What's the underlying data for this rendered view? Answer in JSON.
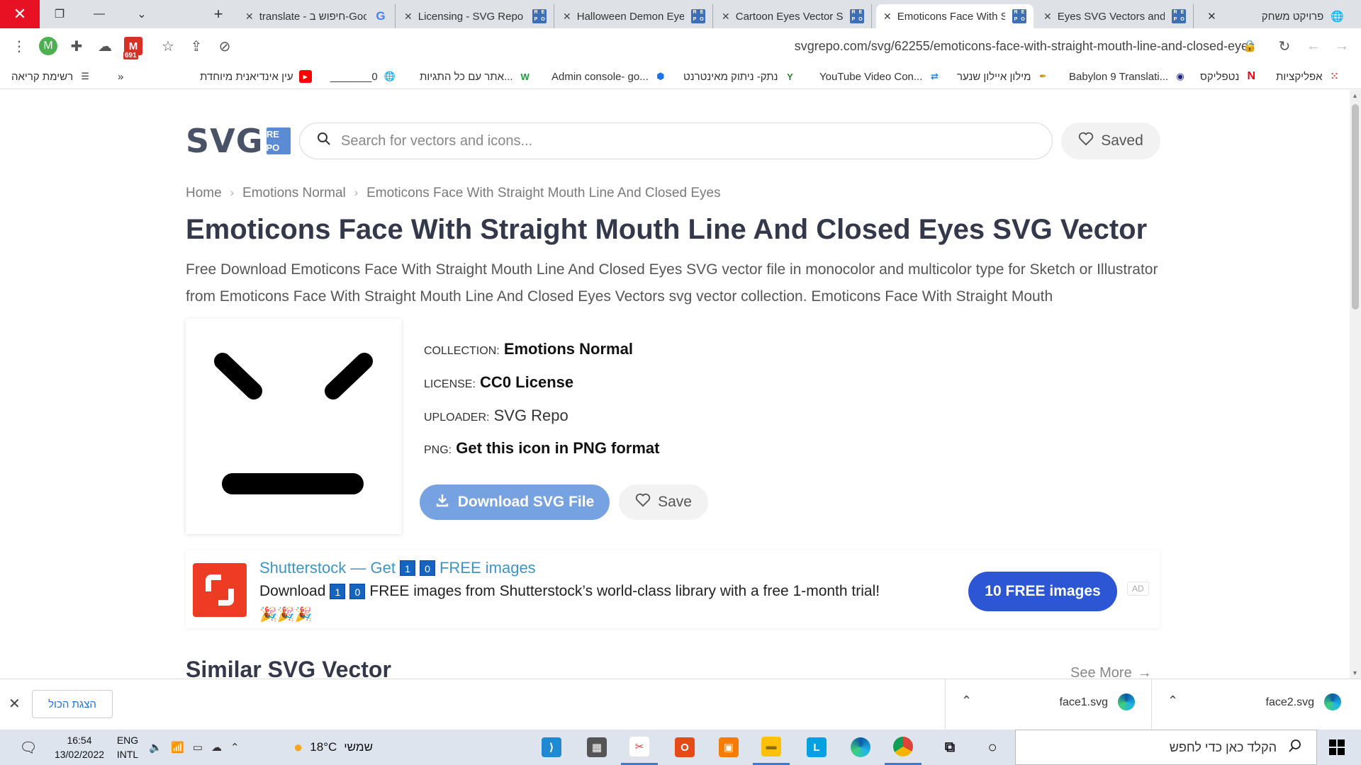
{
  "browser": {
    "tabs": [
      {
        "title": "translate - חיפוש ב-Google",
        "icon": "google-icon"
      },
      {
        "title": "Licensing - SVG Repo",
        "icon": "svgrepo-icon"
      },
      {
        "title": "Halloween Demon Eyes",
        "icon": "svgrepo-icon"
      },
      {
        "title": "Cartoon Eyes Vector S",
        "icon": "svgrepo-icon"
      },
      {
        "title": "Emoticons Face With S",
        "icon": "svgrepo-icon",
        "active": true
      },
      {
        "title": "Eyes SVG Vectors and",
        "icon": "svgrepo-icon"
      }
    ],
    "last_tab": "פרויקט משחק",
    "url": "svgrepo.com/svg/62255/emoticons-face-with-straight-mouth-line-and-closed-eyes",
    "gmail_count": "691",
    "profile_initial": "M",
    "bookmarks": [
      "אפליקציות",
      "נטפליקס",
      "Babylon 9 Translati...",
      "מילון איילון שנער",
      "YouTube Video Con...",
      "נתק- ניתוק מאינטרנט",
      "Admin console- go...",
      "אתר עם כל התגיות...",
      "_______0",
      "עין אינדיאנית מיוחדת",
      "רשימת קריאה"
    ],
    "bookmarks_overflow": "»"
  },
  "site": {
    "logo_main": "SVG",
    "logo_box": [
      "RE",
      "PO"
    ],
    "search_placeholder": "Search for vectors and icons...",
    "saved_label": "Saved",
    "breadcrumb": [
      "Home",
      "Emotions Normal",
      "Emoticons Face With Straight Mouth Line And Closed Eyes"
    ],
    "title": "Emoticons Face With Straight Mouth Line And Closed Eyes SVG Vector",
    "description": "Free Download Emoticons Face With Straight Mouth Line And Closed Eyes SVG vector file in monocolor and multicolor type for Sketch or Illustrator from Emoticons Face With Straight Mouth Line And Closed Eyes Vectors svg vector collection. Emoticons Face With Straight Mouth",
    "meta": {
      "collection_key": "COLLECTION:",
      "collection_val": "Emotions Normal",
      "license_key": "LICENSE:",
      "license_val": "CC0 License",
      "uploader_key": "UPLOADER:",
      "uploader_val": "SVG Repo",
      "png_key": "PNG:",
      "png_val": "Get this icon in PNG format"
    },
    "download_label": "Download SVG File",
    "save_label": "Save",
    "ad": {
      "title_pre": "Shutterstock — Get",
      "title_post": "FREE images",
      "text_pre": "Download",
      "text_post": "FREE images from Shutterstock’s world-class library with a free 1-month trial!",
      "digits": [
        "1",
        "0"
      ],
      "emoji": "🎉🎉🎉",
      "cta": "10 FREE images",
      "tag": "AD"
    },
    "similar_heading": "Similar SVG Vector",
    "see_more": "See More"
  },
  "downloads": {
    "show_all": "הצגת הכול",
    "items": [
      "face1.svg",
      "face2.svg"
    ]
  },
  "taskbar": {
    "search_placeholder": "הקלד כאן כדי לחפש",
    "weather_temp": "18°C",
    "weather_text": "שמשי",
    "lang_top": "ENG",
    "lang_bottom": "INTL",
    "time": "16:54",
    "date": "13/02/2022"
  },
  "colors": {
    "accent_blue": "#76a2e2",
    "cta_blue": "#2d56d4",
    "logo_dark": "#4a5268",
    "shutterstock_red": "#ee3b24"
  }
}
